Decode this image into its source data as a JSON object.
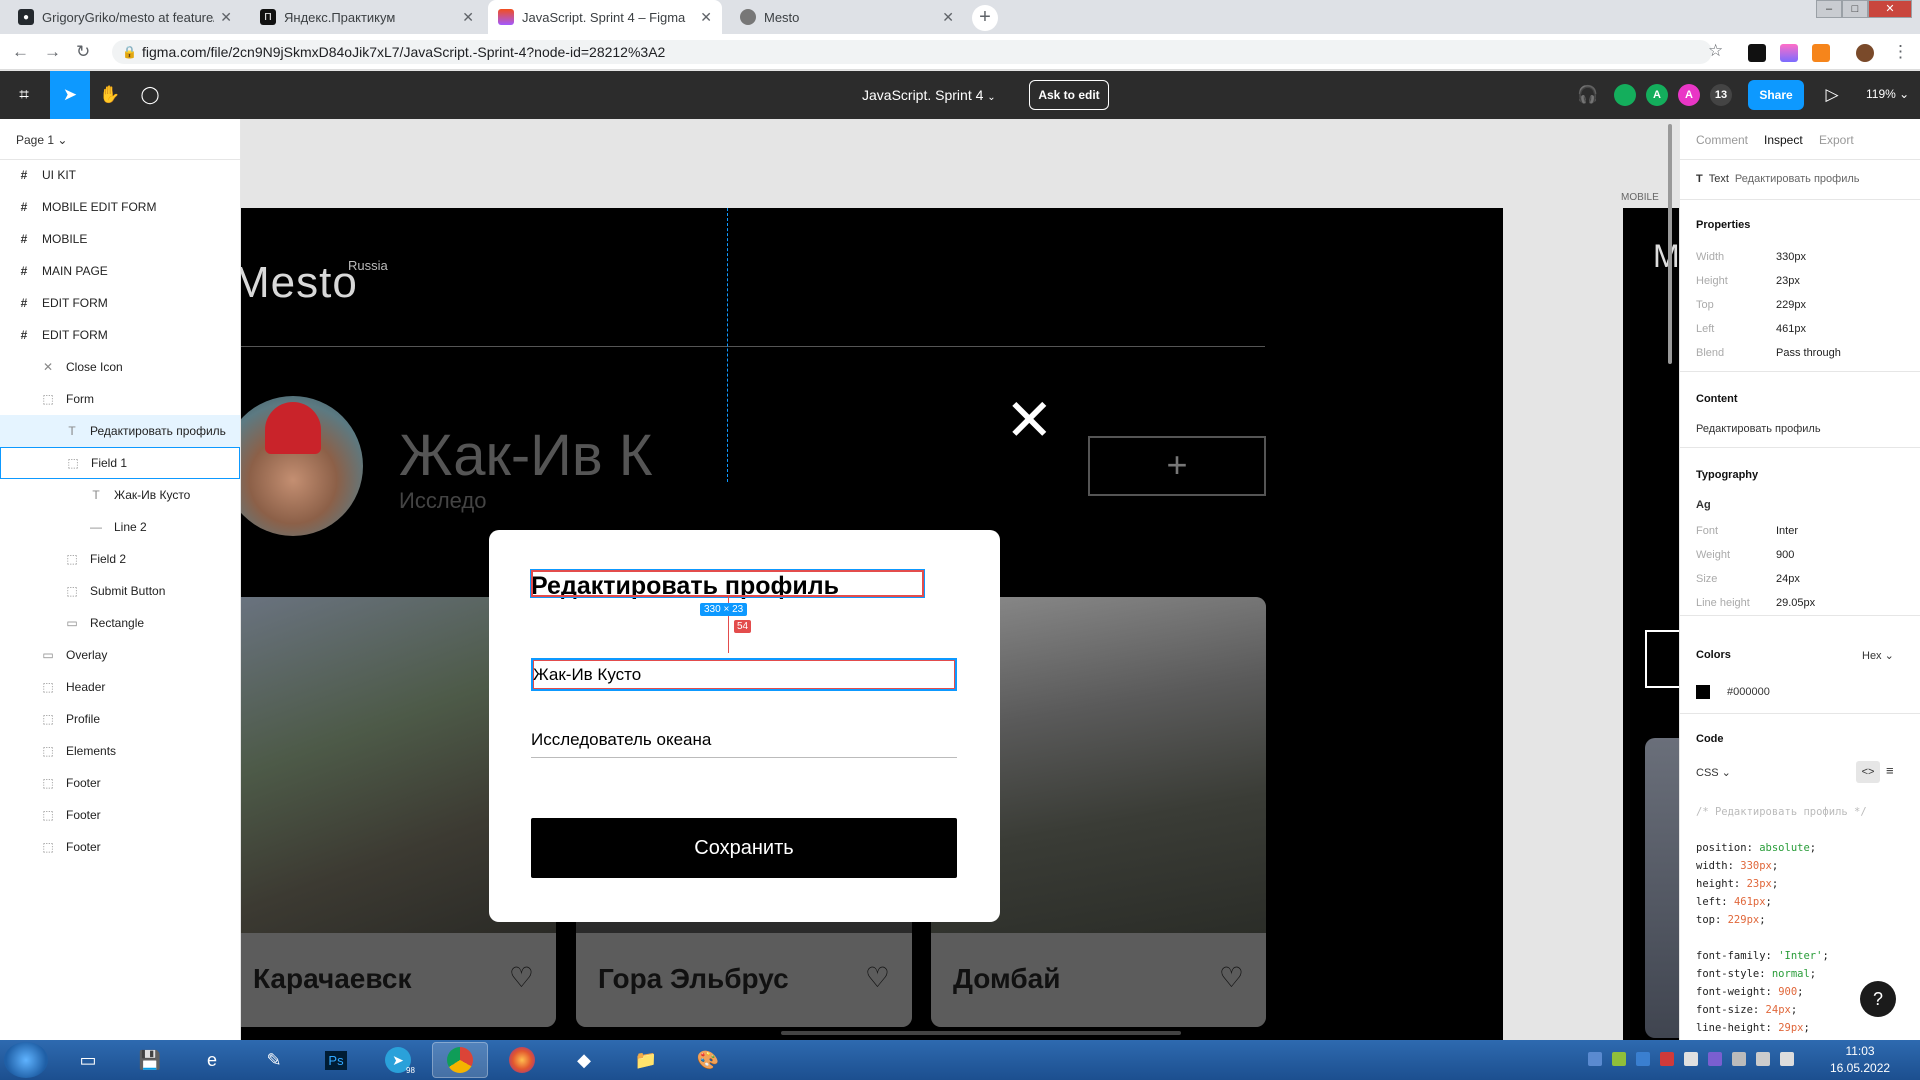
{
  "browser": {
    "tabs": [
      {
        "title": "GrigoryGriko/mesto at feature/h",
        "favicon": "github-icon"
      },
      {
        "title": "Яндекс.Практикум",
        "favicon": "practicum-icon"
      },
      {
        "title": "JavaScript. Sprint 4 – Figma",
        "favicon": "figma-icon"
      },
      {
        "title": "Mesto",
        "favicon": "globe-icon"
      }
    ],
    "url": "figma.com/file/2cn9N9jSkmxD84oJik7xL7/JavaScript.-Sprint-4?node-id=28212%3A2"
  },
  "toolbar": {
    "file_title": "JavaScript. Sprint 4",
    "ask_to_edit": "Ask to edit",
    "avatar_a1": "A",
    "avatar_a2": "A",
    "collaborators_count": "13",
    "share": "Share",
    "zoom": "119%"
  },
  "layers": {
    "page": "Page 1",
    "items": [
      {
        "label": "UI KIT"
      },
      {
        "label": "MOBILE EDIT FORM"
      },
      {
        "label": "MOBILE"
      },
      {
        "label": "MAIN PAGE"
      },
      {
        "label": "EDIT FORM"
      },
      {
        "label": "EDIT FORM"
      },
      {
        "label": "Close Icon"
      },
      {
        "label": "Form"
      },
      {
        "label": "Редактировать профиль"
      },
      {
        "label": "Field 1"
      },
      {
        "label": "Жак-Ив Кусто"
      },
      {
        "label": "Line 2"
      },
      {
        "label": "Field 2"
      },
      {
        "label": "Submit Button"
      },
      {
        "label": "Rectangle"
      },
      {
        "label": "Overlay"
      },
      {
        "label": "Header"
      },
      {
        "label": "Profile"
      },
      {
        "label": "Elements"
      },
      {
        "label": "Footer"
      },
      {
        "label": "Footer"
      },
      {
        "label": "Footer"
      }
    ]
  },
  "canvas": {
    "logo": "Mesto",
    "logo_sub": "Russia",
    "profile_name": "Жак-Ив К",
    "profile_job": "Исследо",
    "add_button": "+",
    "close_icon": "✕",
    "cards": [
      {
        "title": "Карачаевск"
      },
      {
        "title": "Гора Эльбрус"
      },
      {
        "title": "Домбай"
      }
    ],
    "popup": {
      "title": "Редактировать профиль",
      "dimensions": "330 × 23",
      "gap": "54",
      "field1_value": "Жак-Ив Кусто",
      "field2_value": "Исследователь океана",
      "save": "Сохранить"
    },
    "mobile_label": "MOBILE",
    "mobile_logo_letter": "M"
  },
  "inspect": {
    "tabs": [
      "Comment",
      "Inspect",
      "Export"
    ],
    "layer_type": "Text",
    "layer_name": "Редактировать профиль",
    "properties_title": "Properties",
    "properties": [
      {
        "label": "Width",
        "value": "330px"
      },
      {
        "label": "Height",
        "value": "23px"
      },
      {
        "label": "Top",
        "value": "229px"
      },
      {
        "label": "Left",
        "value": "461px"
      },
      {
        "label": "Blend",
        "value": "Pass through"
      }
    ],
    "content_title": "Content",
    "content": "Редактировать профиль",
    "typography_title": "Typography",
    "ag": "Ag",
    "typography": [
      {
        "label": "Font",
        "value": "Inter"
      },
      {
        "label": "Weight",
        "value": "900"
      },
      {
        "label": "Size",
        "value": "24px"
      },
      {
        "label": "Line height",
        "value": "29.05px"
      }
    ],
    "colors_title": "Colors",
    "color_format": "Hex",
    "color_value": "#000000",
    "code_title": "Code",
    "code_lang": "CSS"
  },
  "taskbar": {
    "telegram_badge": "98",
    "clock_time": "11:03",
    "clock_date": "16.05.2022"
  },
  "colors": {
    "figma_blue": "#0d99ff",
    "measure_red": "#e34c4c"
  }
}
